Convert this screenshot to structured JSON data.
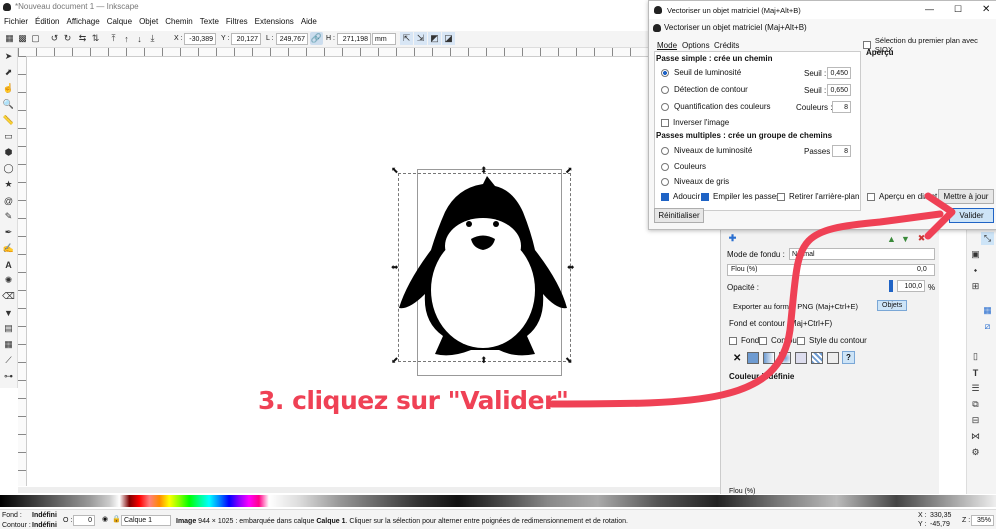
{
  "window": {
    "title": "*Nouveau document 1 — Inkscape"
  },
  "menu": [
    "Fichier",
    "Édition",
    "Affichage",
    "Calque",
    "Objet",
    "Chemin",
    "Texte",
    "Filtres",
    "Extensions",
    "Aide"
  ],
  "toolbar": {
    "x_label": "X :",
    "x_value": "-30,389",
    "y_label": "Y :",
    "y_value": "20,127",
    "w_label": "L :",
    "w_value": "249,767",
    "h_label": "H :",
    "h_value": "271,198",
    "unit": "mm"
  },
  "dialog": {
    "window_title": "Vectoriser un objet matriciel (Maj+Alt+B)",
    "panel_title": "Vectoriser un objet matriciel (Maj+Alt+B)",
    "tabs": [
      "Mode",
      "Options",
      "Crédits"
    ],
    "single_pass_header": "Passe simple : crée un chemin",
    "brightness": {
      "label": "Seuil de luminosité",
      "param_label": "Seuil :",
      "value": "0,450",
      "selected": true
    },
    "edge": {
      "label": "Détection de contour",
      "param_label": "Seuil :",
      "value": "0,650"
    },
    "color_quant": {
      "label": "Quantification des couleurs",
      "param_label": "Couleurs :",
      "value": "8"
    },
    "invert_label": "Inverser l'image",
    "multi_pass_header": "Passes multiples : crée un groupe de chemins",
    "multi_brightness": {
      "label": "Niveaux de luminosité",
      "param_label": "Passes :",
      "value": "8"
    },
    "colors_label": "Couleurs",
    "grays_label": "Niveaux de gris",
    "smooth_label": "Adoucir",
    "stack_label": "Empiler les passes",
    "remove_bg_label": "Retirer l'arrière-plan",
    "siox_label": "Sélection du premier plan avec SIOX",
    "preview_header": "Aperçu",
    "live_preview_label": "Aperçu en direct",
    "update_button": "Mettre à jour",
    "reset_button": "Réinitialiser",
    "validate_button": "Valider"
  },
  "fill_panel": {
    "blend_label": "Mode de fondu :",
    "blend_value": "Normal",
    "blur_label": "Flou (%)",
    "blur_value": "0,0",
    "opacity_label": "Opacité :",
    "opacity_value": "100,0",
    "opacity_unit": "%",
    "export_label": "Exporter au format PNG (Maj+Ctrl+E)",
    "objects_label": "Objets",
    "fill_stroke_title": "Fond et contour (Maj+Ctrl+F)",
    "tab_fill": "Fond",
    "tab_stroke": "Contour",
    "tab_style": "Style du contour",
    "undefined_label": "Couleur indéfinie",
    "blur_bottom": "Flou (%)"
  },
  "annotation": {
    "text": "3. cliquez sur \"Valider\"",
    "color": "#ef4155"
  },
  "statusbar": {
    "fill_label": "Fond :",
    "fill_value": "Indéfini",
    "stroke_label": "Contour :",
    "stroke_value": "Indéfini",
    "opacity_label": "O :",
    "opacity_value": "0",
    "layer": "Calque 1",
    "message_bold": "Image",
    "message": " 944 × 1025 : embarquée dans calque ",
    "message_layer": "Calque 1",
    "message_tail": ". Cliquer sur la sélection pour alterner entre poignées de redimensionnement et de rotation.",
    "x_label": "X :",
    "x_value": "330,35",
    "y_label": "Y :",
    "y_value": "-45,79",
    "zoom_label": "Z :",
    "zoom_value": "35%"
  },
  "colors": {
    "accent": "#1f63c5",
    "arrow": "#ef4155",
    "validate_bg": "#cde4f7"
  }
}
